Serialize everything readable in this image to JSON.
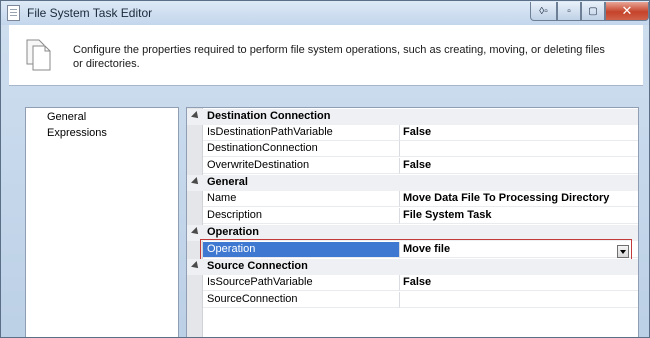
{
  "window": {
    "title": "File System Task Editor",
    "caption": {
      "restore": "◊▫",
      "minimize": "▫",
      "maximize": "▢",
      "close": "✕"
    }
  },
  "header": {
    "description": "Configure the properties required to perform file system operations, such as creating, moving, or deleting files or directories.",
    "icon": "document-stack-icon"
  },
  "nav": {
    "items": [
      {
        "label": "General"
      },
      {
        "label": "Expressions"
      }
    ]
  },
  "grid": {
    "categories": [
      {
        "label": "Destination Connection",
        "props": [
          {
            "name": "IsDestinationPathVariable",
            "value": "False"
          },
          {
            "name": "DestinationConnection",
            "value": ""
          },
          {
            "name": "OverwriteDestination",
            "value": "False"
          }
        ]
      },
      {
        "label": "General",
        "props": [
          {
            "name": "Name",
            "value": "Move Data File To Processing Directory"
          },
          {
            "name": "Description",
            "value": "File System Task"
          }
        ]
      },
      {
        "label": "Operation",
        "props": [
          {
            "name": "Operation",
            "value": "Move file",
            "selected": true
          }
        ]
      },
      {
        "label": "Source Connection",
        "props": [
          {
            "name": "IsSourcePathVariable",
            "value": "False"
          },
          {
            "name": "SourceConnection",
            "value": ""
          }
        ]
      }
    ]
  },
  "colors": {
    "selection": "#3e78d0",
    "highlight_outline": "#c23a3a",
    "close_button": "#c5432a"
  }
}
